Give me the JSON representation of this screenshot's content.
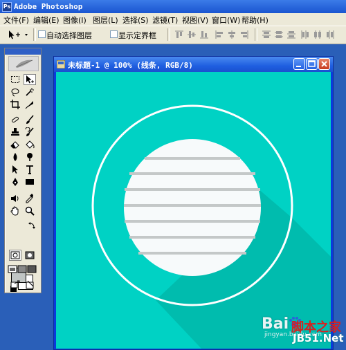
{
  "app": {
    "title": "Adobe Photoshop",
    "logo": "Ps"
  },
  "menu": [
    {
      "label": "文件(F)"
    },
    {
      "label": "编辑(E)"
    },
    {
      "label": "图像(I)"
    },
    {
      "label": "图层(L)"
    },
    {
      "label": "选择(S)"
    },
    {
      "label": "滤镜(T)"
    },
    {
      "label": "视图(V)"
    },
    {
      "label": "窗口(W)"
    },
    {
      "label": "帮助(H)"
    }
  ],
  "options": {
    "auto_select_layer": {
      "label": "自动选择图层",
      "checked": false
    },
    "show_bounding_box": {
      "label": "显示定界框",
      "checked": false
    }
  },
  "toolbox": {
    "foreground_color": "#c0c5c4",
    "background_color": "#ffffff"
  },
  "document": {
    "title": "未标题-1 @ 100% (线条, RGB/8)",
    "canvas_color": "#00d2c4",
    "circle_fill": "#f7fafb",
    "line_color": "#c4c8c8",
    "shadow_color": "#00bcae"
  },
  "watermark": {
    "baidu": "Bai",
    "jingyan": "jingyan.baidu.com",
    "site_cn": "脚本之家",
    "site_en": "JB51.Net"
  }
}
